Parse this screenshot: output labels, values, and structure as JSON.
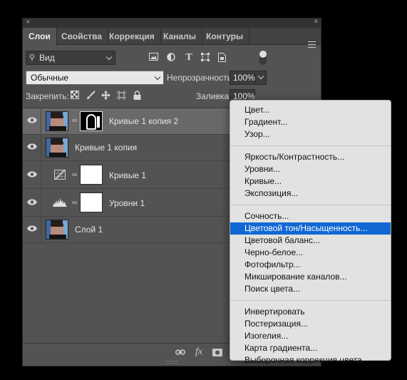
{
  "titlebar": {
    "close": "×",
    "collapse": "‹‹"
  },
  "tabs": [
    {
      "label": "Слои",
      "active": true
    },
    {
      "label": "Свойства",
      "active": false
    },
    {
      "label": "Коррекция",
      "active": false
    },
    {
      "label": "Каналы",
      "active": false
    },
    {
      "label": "Контуры",
      "active": false
    }
  ],
  "filter": {
    "kind_label": "Вид",
    "icons": [
      "image-filter-icon",
      "adjustment-filter-icon",
      "type-filter-icon",
      "shape-filter-icon",
      "smart-object-filter-icon"
    ]
  },
  "blend": {
    "mode": "Обычные",
    "opacity_label": "Непрозрачность:",
    "opacity_value": "100%"
  },
  "lock": {
    "label": "Закрепить:",
    "fill_label": "Заливка:",
    "fill_value": "100%"
  },
  "layers": [
    {
      "name": "Кривые 1 копия 2",
      "selected": true,
      "type": "image-with-mask"
    },
    {
      "name": "Кривые 1 копия",
      "selected": false,
      "type": "image"
    },
    {
      "name": "Кривые 1",
      "selected": false,
      "type": "curves-adjustment"
    },
    {
      "name": "Уровни 1",
      "selected": false,
      "type": "levels-adjustment"
    },
    {
      "name": "Слой 1",
      "selected": false,
      "type": "image"
    }
  ],
  "footer": {
    "link": "⊖",
    "fx": "fx"
  },
  "menu": {
    "groups": [
      [
        "Цвет...",
        "Градиент...",
        "Узор..."
      ],
      [
        "Яркость/Контрастность...",
        "Уровни...",
        "Кривые...",
        "Экспозиция..."
      ],
      [
        "Сочность...",
        "Цветовой тон/Насыщенность...",
        "Цветовой баланс...",
        "Черно-белое...",
        "Фотофильтр...",
        "Микширование каналов...",
        "Поиск цвета..."
      ],
      [
        "Инвертировать",
        "Постеризация...",
        "Изогелия...",
        "Карта градиента...",
        "Выборочная коррекция цвета..."
      ]
    ],
    "highlighted": "Цветовой тон/Насыщенность..."
  },
  "colors": {
    "panel_bg": "#535353",
    "selected_layer": "#696969",
    "menu_bg": "#e2e2e2",
    "menu_highlight": "#1167d4"
  }
}
